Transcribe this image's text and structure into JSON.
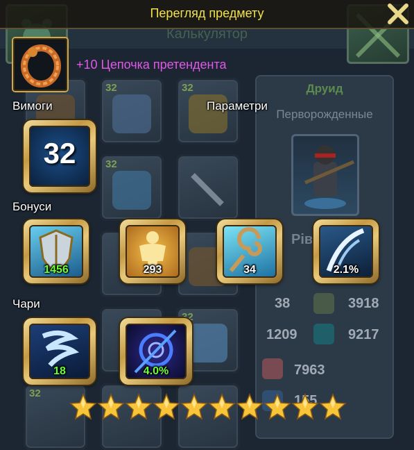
{
  "popup": {
    "title": "Перегляд предмету",
    "close_icon": "close-x-icon"
  },
  "background": {
    "calculator_label": "Калькулятор",
    "character_class": "Друид",
    "character_race": "Перворожденные",
    "partial_label": "Рів",
    "cell_level": "32",
    "stats": [
      {
        "left": "38",
        "right": "3918"
      },
      {
        "left": "1209",
        "right": "9217"
      },
      {
        "value": "7963"
      },
      {
        "value": "155"
      }
    ]
  },
  "item": {
    "name": "+10 Цепочка претендента",
    "icon": "ring-chain-icon",
    "name_color": "#e357e8"
  },
  "sections": {
    "requirements": "Вимоги",
    "parameters": "Параметри",
    "bonuses": "Бонуси",
    "enchants": "Чари"
  },
  "requirements": {
    "level": "32"
  },
  "bonuses": [
    {
      "icon": "shield-icon",
      "value": "1456"
    },
    {
      "icon": "strength-figure-icon",
      "value": "293"
    },
    {
      "icon": "wind-spiral-icon",
      "value": "34"
    },
    {
      "icon": "slash-strike-icon",
      "value": "2.1%"
    }
  ],
  "enchants": [
    {
      "icon": "water-whirl-icon",
      "value": "18"
    },
    {
      "icon": "dark-vortex-icon",
      "value": "4.0%"
    }
  ],
  "stars": {
    "count": 10,
    "icon": "gold-star-icon"
  },
  "colors": {
    "title": "#f3e14a",
    "green_value": "#6bff3a",
    "gold_frame": "#c59a45"
  }
}
